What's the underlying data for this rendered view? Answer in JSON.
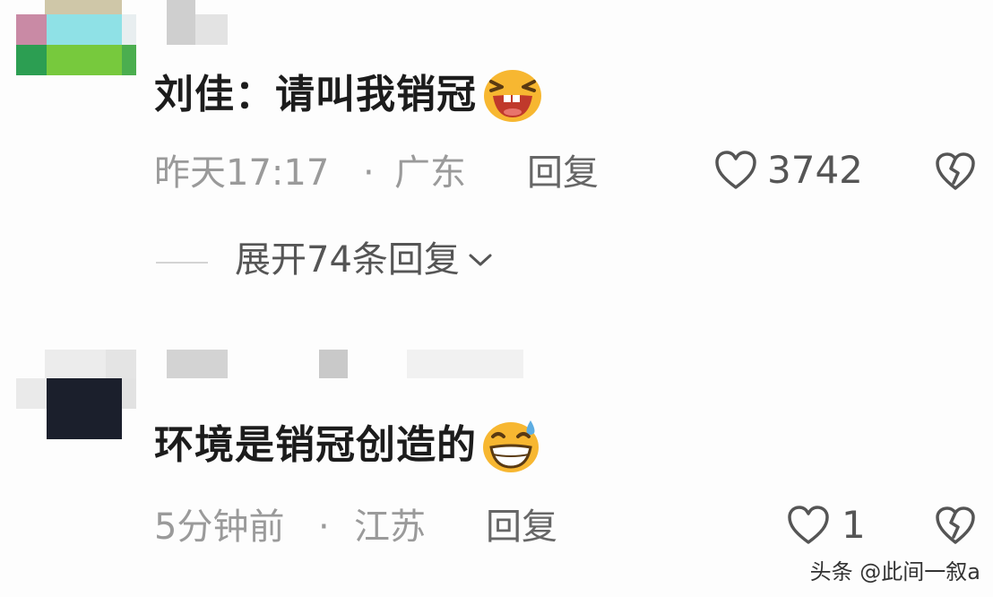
{
  "comments": [
    {
      "text": "刘佳：请叫我销冠",
      "emoji": "grinning-squint-emoji",
      "time": "昨天17:17",
      "separator": "·",
      "location": "广东",
      "reply_label": "回复",
      "like_icon": "heart-outline-icon",
      "like_count": "3742",
      "dislike_icon": "broken-heart-icon",
      "expand_label": "展开74条回复",
      "expand_icon": "chevron-down-icon"
    },
    {
      "text": "环境是销冠创造的",
      "emoji": "grin-sweat-emoji",
      "time": "5分钟前",
      "separator": "·",
      "location": "江苏",
      "reply_label": "回复",
      "like_icon": "heart-outline-icon",
      "like_count": "1",
      "dislike_icon": "broken-heart-icon"
    }
  ],
  "watermark": "头条 @此间一叙a",
  "colors": {
    "text": "#1c1c1c",
    "meta": "#9a9a9a",
    "emoji_face": "#f7b731",
    "emoji_mouth": "#c0392b"
  }
}
